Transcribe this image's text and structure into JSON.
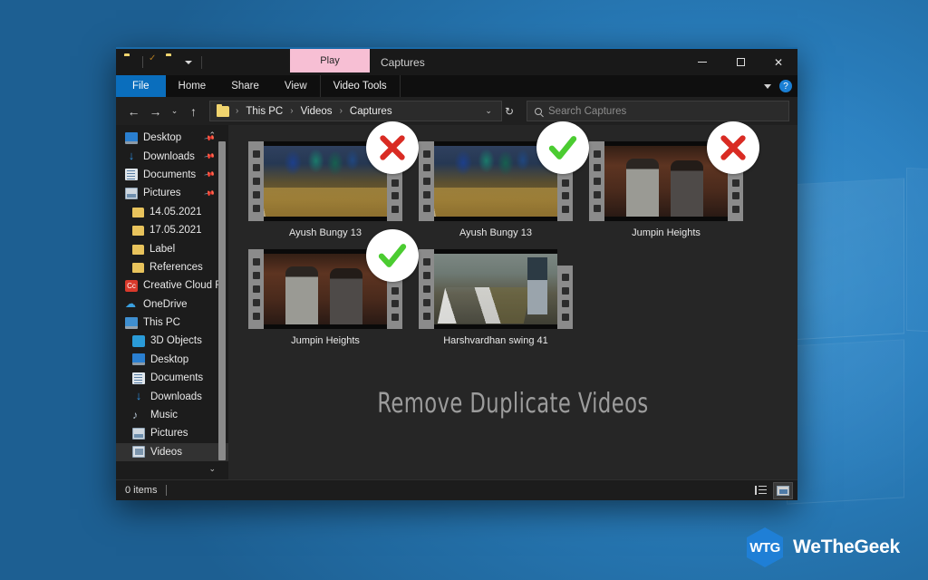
{
  "window": {
    "title": "Captures",
    "play_tab": "Play",
    "quick_access": [
      "folder-icon",
      "properties-icon",
      "new-folder-icon",
      "customize-caret-icon"
    ],
    "controls": {
      "minimize": "minimize-icon",
      "maximize": "maximize-icon",
      "close": "✕"
    }
  },
  "ribbon": {
    "tabs": [
      {
        "label": "File",
        "name": "tab-file"
      },
      {
        "label": "Home",
        "name": "tab-home"
      },
      {
        "label": "Share",
        "name": "tab-share"
      },
      {
        "label": "View",
        "name": "tab-view"
      },
      {
        "label": "Video Tools",
        "name": "tab-video-tools"
      }
    ],
    "collapse_caret": "chevron-down-icon",
    "help": "?"
  },
  "address": {
    "back": "←",
    "forward": "→",
    "recent_caret": "⌄",
    "up": "↑",
    "crumbs": [
      "This PC",
      "Videos",
      "Captures"
    ],
    "separator": "›",
    "dropdown_caret": "⌄",
    "refresh": "↻"
  },
  "search": {
    "placeholder": "Search Captures",
    "icon": "search-icon"
  },
  "sidebar": {
    "items": [
      {
        "label": "Desktop",
        "icon": "desktop-icon",
        "pinned": true,
        "selected": false,
        "indent": 0
      },
      {
        "label": "Downloads",
        "icon": "download-icon",
        "pinned": true,
        "selected": false,
        "indent": 0
      },
      {
        "label": "Documents",
        "icon": "documents-icon",
        "pinned": true,
        "selected": false,
        "indent": 0
      },
      {
        "label": "Pictures",
        "icon": "pictures-icon",
        "pinned": true,
        "selected": false,
        "indent": 0
      },
      {
        "label": "14.05.2021",
        "icon": "folder-icon",
        "pinned": false,
        "selected": false,
        "indent": 1
      },
      {
        "label": "17.05.2021",
        "icon": "folder-icon",
        "pinned": false,
        "selected": false,
        "indent": 1
      },
      {
        "label": "Label",
        "icon": "folder-icon",
        "pinned": false,
        "selected": false,
        "indent": 1
      },
      {
        "label": "References",
        "icon": "folder-icon",
        "pinned": false,
        "selected": false,
        "indent": 1
      },
      {
        "label": "Creative Cloud Fil",
        "icon": "creative-cloud-icon",
        "pinned": false,
        "selected": false,
        "indent": 0
      },
      {
        "label": "OneDrive",
        "icon": "cloud-icon",
        "pinned": false,
        "selected": false,
        "indent": 0
      },
      {
        "label": "This PC",
        "icon": "this-pc-icon",
        "pinned": false,
        "selected": false,
        "indent": 0
      },
      {
        "label": "3D Objects",
        "icon": "3d-objects-icon",
        "pinned": false,
        "selected": false,
        "indent": 1
      },
      {
        "label": "Desktop",
        "icon": "desktop-icon",
        "pinned": false,
        "selected": false,
        "indent": 1
      },
      {
        "label": "Documents",
        "icon": "documents-icon",
        "pinned": false,
        "selected": false,
        "indent": 1
      },
      {
        "label": "Downloads",
        "icon": "download-icon",
        "pinned": false,
        "selected": false,
        "indent": 1
      },
      {
        "label": "Music",
        "icon": "music-icon",
        "pinned": false,
        "selected": false,
        "indent": 1
      },
      {
        "label": "Pictures",
        "icon": "pictures-icon",
        "pinned": false,
        "selected": false,
        "indent": 1
      },
      {
        "label": "Videos",
        "icon": "videos-icon",
        "pinned": false,
        "selected": true,
        "indent": 1
      }
    ],
    "scroll_up": "⌃",
    "scroll_down": "⌄"
  },
  "files": [
    {
      "name": "Ayush Bungy 13",
      "art": "art-bungy",
      "badge": "x",
      "badge_name": "duplicate-remove-badge"
    },
    {
      "name": "Ayush Bungy 13",
      "art": "art-bungy",
      "badge": "check",
      "badge_name": "duplicate-keep-badge"
    },
    {
      "name": "Jumpin Heights",
      "art": "art-jump",
      "badge": "x",
      "badge_name": "duplicate-remove-badge"
    },
    {
      "name": "Jumpin Heights",
      "art": "art-jump",
      "badge": "check",
      "badge_name": "duplicate-keep-badge"
    },
    {
      "name": "Harshvardhan swing 41",
      "art": "art-swing",
      "badge": "none",
      "badge_name": ""
    }
  ],
  "watermark": "Remove Duplicate Videos",
  "statusbar": {
    "items_count": "0 items",
    "details_view": "details-view-icon",
    "large_icons_view": "large-icons-view-icon"
  },
  "brand": {
    "mark": "WTG",
    "name": "WeTheGeek"
  },
  "colors": {
    "accent_blue": "#0a6ebd",
    "play_tab_pink": "#f7bfd4",
    "badge_red": "#d92b23",
    "badge_green": "#4bcc31",
    "window_bg": "#202020",
    "content_bg": "#262626",
    "wallpaper_blue": "#1f6396"
  }
}
